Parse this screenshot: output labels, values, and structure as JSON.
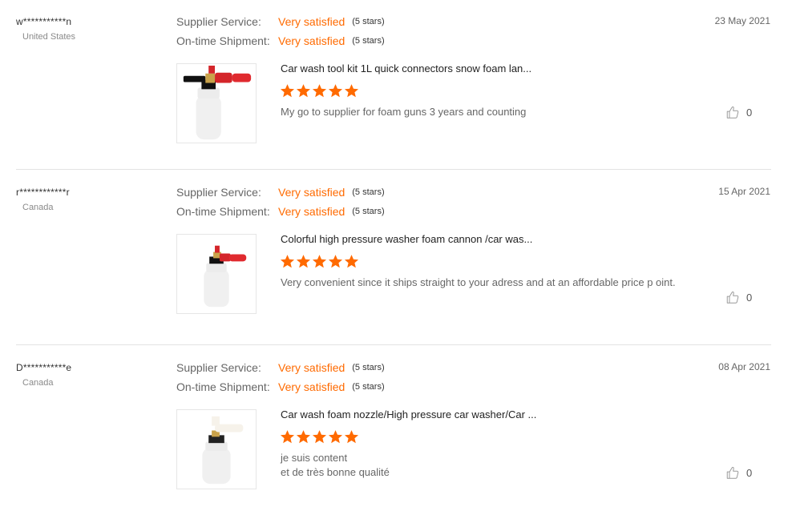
{
  "colors": {
    "accent": "#ff6a00",
    "star": "#ff6a00",
    "divider": "#e3e3e3"
  },
  "reviews": [
    {
      "user": "w***********n",
      "country": "United States",
      "supplier_label": "Supplier Service:",
      "supplier_value": "Very satisfied",
      "supplier_stars": "(5 stars)",
      "shipment_label": "On-time Shipment:",
      "shipment_value": "Very satisfied",
      "shipment_stars": "(5 stars)",
      "date": "23 May 2021",
      "product_title": "Car wash tool kit 1L quick connectors snow foam lan...",
      "rating": 5,
      "comment": "My go to supplier for foam guns 3 years and counting",
      "helpful_count": "0",
      "icon": "thumbs-up-icon"
    },
    {
      "user": "r************r",
      "country": "Canada",
      "supplier_label": "Supplier Service:",
      "supplier_value": "Very satisfied",
      "supplier_stars": "(5 stars)",
      "shipment_label": "On-time Shipment:",
      "shipment_value": "Very satisfied",
      "shipment_stars": "(5 stars)",
      "date": "15 Apr 2021",
      "product_title": "Colorful high pressure washer foam cannon /car was...",
      "rating": 5,
      "comment": "Very convenient since it ships straight to your adress and at an affordable price p oint.",
      "helpful_count": "0",
      "icon": "thumbs-up-icon"
    },
    {
      "user": "D***********e",
      "country": "Canada",
      "supplier_label": "Supplier Service:",
      "supplier_value": "Very satisfied",
      "supplier_stars": "(5 stars)",
      "shipment_label": "On-time Shipment:",
      "shipment_value": "Very satisfied",
      "shipment_stars": "(5 stars)",
      "date": "08 Apr 2021",
      "product_title": "Car wash foam nozzle/High pressure car washer/Car ...",
      "rating": 5,
      "comment_line1": "je suis content",
      "comment_line2": "et de très bonne qualité",
      "helpful_count": "0",
      "icon": "thumbs-up-icon"
    }
  ]
}
